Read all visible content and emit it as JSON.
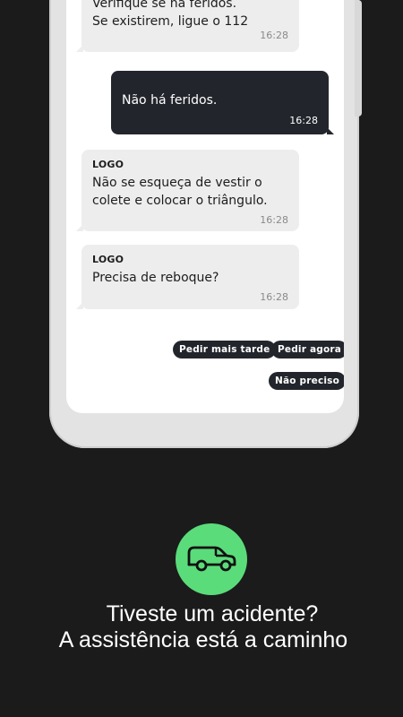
{
  "chat": {
    "messages": [
      {
        "direction": "in",
        "sender": "",
        "lines": [
          "Verifique se há feridos.",
          "Se existirem, ligue o 112"
        ],
        "time": "16:28"
      },
      {
        "direction": "out",
        "sender": "",
        "lines": [
          "Não há feridos."
        ],
        "time": "16:28"
      },
      {
        "direction": "in",
        "sender": "LOGO",
        "lines": [
          "Não se esqueça de vestir o",
          "colete e colocar o triângulo."
        ],
        "time": "16:28"
      },
      {
        "direction": "in",
        "sender": "LOGO",
        "lines": [
          "Precisa de reboque?"
        ],
        "time": "16:28"
      }
    ],
    "quick_replies": [
      "Pedir mais tarde",
      "Pedir agora",
      "Não preciso"
    ]
  },
  "promo": {
    "icon": "car-icon",
    "accent_color": "#5bdc7b",
    "headline_line1": "Tiveste um acidente?",
    "headline_line2": "A assistência está a caminho"
  },
  "colors": {
    "background": "#1b1b1b",
    "incoming_bubble": "#ededed",
    "outgoing_bubble": "#22262c"
  }
}
